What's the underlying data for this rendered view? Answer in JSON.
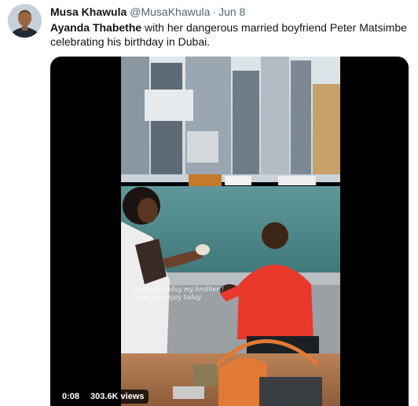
{
  "tweet": {
    "author_name": "Musa Khawula",
    "author_handle": "@MusaKhawula",
    "separator": "·",
    "date": "Jun 8",
    "text_bold": "Ayanda Thabethe",
    "text_rest": " with her dangerous married boyfriend Peter Matsimbe celebrating his birthday in Dubai."
  },
  "video": {
    "duration": "0:08",
    "views": "303.6K views",
    "overlay_caption": "Happy birthday my brother !\nHope you enjoy today\n...\n...    ...    ..."
  },
  "colors": {
    "text_primary": "#0f1419",
    "text_secondary": "#536471",
    "media_background": "#000000",
    "shirt_red": "#e8392c",
    "bag_orange": "#e07a35",
    "water": "#4f8b8e"
  },
  "icons": {
    "avatar": "profile-photo"
  }
}
